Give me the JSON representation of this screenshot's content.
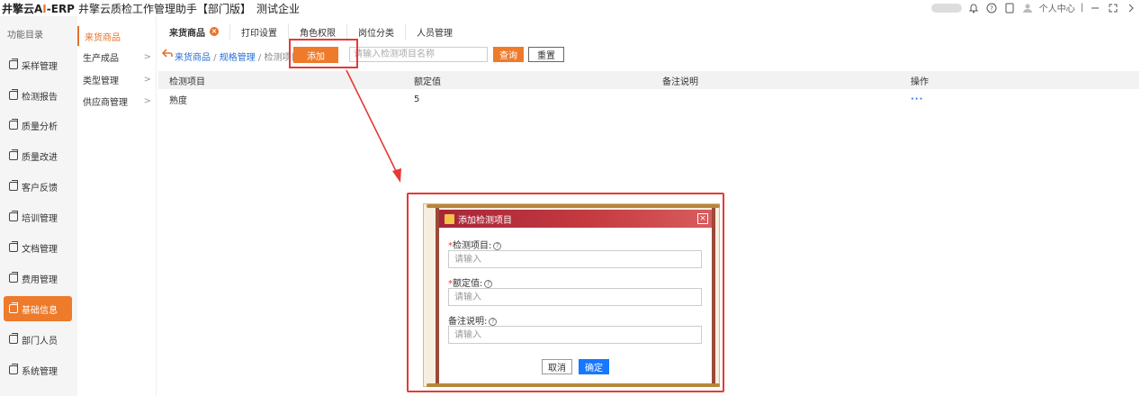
{
  "header": {
    "brand_prefix": "井擎云A",
    "brand_ai": "I",
    "brand_suffix": "-ERP",
    "app_title": "井擎云质检工作管理助手【部门版】",
    "company": "测试企业",
    "user_label": "个人中心",
    "icons": [
      "toggle",
      "bell-icon",
      "help-icon",
      "phone-icon",
      "avatar",
      "minimize-icon",
      "fullscreen-icon",
      "chevron-right-icon"
    ]
  },
  "sidebar": {
    "title": "功能目录",
    "items": [
      {
        "label": "采样管理"
      },
      {
        "label": "检测报告"
      },
      {
        "label": "质量分析"
      },
      {
        "label": "质量改进"
      },
      {
        "label": "客户反馈"
      },
      {
        "label": "培训管理"
      },
      {
        "label": "文档管理"
      },
      {
        "label": "费用管理"
      },
      {
        "label": "基础信息",
        "active": true
      },
      {
        "label": "部门人员"
      },
      {
        "label": "系统管理"
      }
    ]
  },
  "subnav": {
    "items": [
      {
        "label": "来货商品",
        "active": true
      },
      {
        "label": "生产成品",
        "chevron": ">"
      },
      {
        "label": "类型管理",
        "chevron": ">"
      },
      {
        "label": "供应商管理",
        "chevron": ">"
      }
    ]
  },
  "tabs": [
    {
      "label": "来货商品",
      "active": true,
      "close": "×"
    },
    {
      "label": "打印设置"
    },
    {
      "label": "角色权限"
    },
    {
      "label": "岗位分类"
    },
    {
      "label": "人员管理"
    }
  ],
  "toolbar": {
    "breadcrumb": {
      "link1": "来货商品",
      "sep1": " / ",
      "link2": "规格管理",
      "sep2": " / ",
      "current": "检测项目"
    },
    "add_label": "添加",
    "search_placeholder": "请输入检测项目名称",
    "query_label": "查询",
    "reset_label": "重置"
  },
  "table": {
    "columns": [
      "检测项目",
      "额定值",
      "备注说明",
      "操作"
    ],
    "rows": [
      {
        "item": "熟度",
        "rated": "5",
        "remark": "",
        "action": "···"
      }
    ]
  },
  "modal": {
    "title": "添加检测项目",
    "close": "×",
    "fields": [
      {
        "label": "检测项目",
        "required": "*",
        "help": "?",
        "placeholder": "请输入"
      },
      {
        "label": "额定值",
        "required": "*",
        "help": "?",
        "placeholder": "请输入"
      },
      {
        "label": "备注说明",
        "required": "",
        "help": "?",
        "placeholder": "请输入"
      }
    ],
    "cancel_label": "取消",
    "ok_label": "确定"
  },
  "colors": {
    "accent": "#ee7a2b",
    "primary": "#1677ff",
    "highlight": "#e53935",
    "modal_header": "#c43a3f"
  }
}
